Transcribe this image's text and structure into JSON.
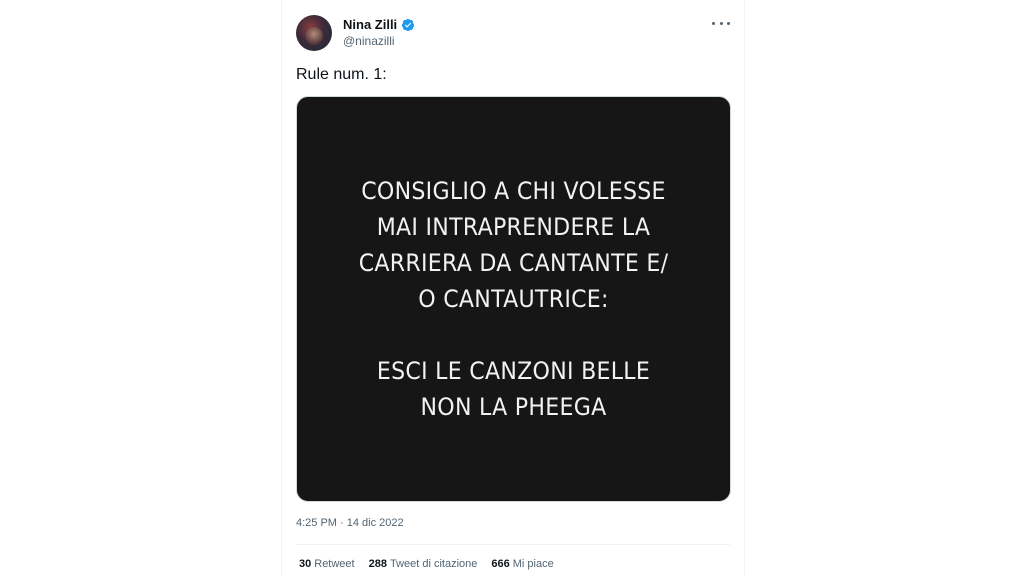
{
  "author": {
    "display_name": "Nina Zilli",
    "handle": "@ninazilli",
    "verified": true
  },
  "tweet": {
    "text": "Rule num. 1:",
    "image_text": {
      "line1": "CONSIGLIO A CHI VOLESSE",
      "line2": "MAI INTRAPRENDERE LA",
      "line3": "CARRIERA DA CANTANTE E/",
      "line4": "O CANTAUTRICE:",
      "line5": "ESCI LE CANZONI BELLE",
      "line6": "NON LA PHEEGA"
    },
    "timestamp": "4:25 PM · 14 dic 2022"
  },
  "stats": {
    "retweets": {
      "count": "30",
      "label": "Retweet"
    },
    "quotes": {
      "count": "288",
      "label": "Tweet di citazione"
    },
    "likes": {
      "count": "666",
      "label": "Mi piace"
    }
  },
  "icons": {
    "verified": "verified-badge-icon",
    "more": "more-options-icon"
  },
  "colors": {
    "verified_blue": "#1d9bf0",
    "secondary_text": "#536471",
    "primary_text": "#0f1419",
    "media_background": "#161616"
  }
}
